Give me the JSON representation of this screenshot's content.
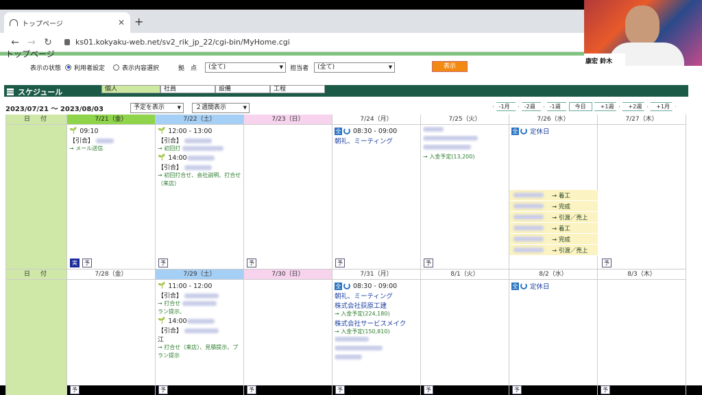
{
  "browser": {
    "tab_title": "トップページ",
    "url": "ks01.kokyaku-web.net/sv2_rik_jp_22/cgi-bin/MyHome.cgi"
  },
  "page": {
    "title": "トップページ",
    "display_state_label": "表示の状態",
    "radio_user_settings": "利用者設定",
    "radio_content_select": "表示内容選択",
    "base_label": "拠　点",
    "base_value": "(全て)",
    "owner_label": "担当者",
    "owner_value": "(全て)",
    "show_button": "表示"
  },
  "schedule": {
    "title": "スケジュール",
    "tabs": [
      "個人",
      "社員",
      "設備",
      "工程"
    ],
    "range": "2023/07/21 ～ 2023/08/03",
    "filter_select": "予定を表示",
    "period_select": "２週間表示",
    "nav": [
      "-1月",
      "-2週",
      "-1週",
      "今日",
      "+1週",
      "+2週",
      "+1月"
    ],
    "day_label": "日　付",
    "week1_headers": [
      "7/21（金）",
      "7/22（土）",
      "7/23（日）",
      "7/24（月）",
      "7/25（火）",
      "7/26（水）",
      "7/27（木）"
    ],
    "week2_headers": [
      "7/28（金）",
      "7/29（土）",
      "7/30（日）",
      "7/31（月）",
      "8/1（火）",
      "8/2（水）",
      "8/3（木）"
    ],
    "yo": "予",
    "jitsu": "実",
    "zen": "全"
  },
  "events": {
    "w1_fri": {
      "time": "09:10",
      "line1": "【引合】",
      "note": "→ メール送信"
    },
    "w1_sat": {
      "time1": "12:00 - 13:00",
      "line1": "【引合】",
      "note1": "→ 初回打",
      "time2": "14:00",
      "line2": "【引合】",
      "note2a": "→ 初回打合せ、会社説明、打合せ",
      "note2b": "（来店）"
    },
    "w1_mon": {
      "time": "08:30 - 09:00",
      "title": "朝礼、ミーティング"
    },
    "w1_tue": {
      "note": "→ 入金予定(13,200)"
    },
    "w1_wed": {
      "title": "定休日",
      "items": [
        "→ 着工",
        "→ 完成",
        "→ 引渡／売上",
        "→ 着工",
        "→ 完成",
        "→ 引渡／売上"
      ]
    },
    "w2_sat": {
      "time1": "11:00 - 12:00",
      "line1": "【引合】",
      "note1": "→ 打合せ",
      "note1b": "ラン提示、",
      "time2": "14:00",
      "line2": "【引合】",
      "line2b": "江",
      "note2a": "→ 打合せ（来店）、見積提示、プ",
      "note2b": "ラン提示"
    },
    "w2_mon": {
      "time": "08:30 - 09:00",
      "title": "朝礼、ミーティング",
      "company1": "株式会社荻原工建",
      "note1": "→ 入金予定(224,180)",
      "company2": "株式会社サービスメイク",
      "note2": "→ 入金予定(150,810)"
    },
    "w2_wed": {
      "title": "定休日"
    }
  },
  "webcam": {
    "name_label": "康宏 鈴木"
  }
}
